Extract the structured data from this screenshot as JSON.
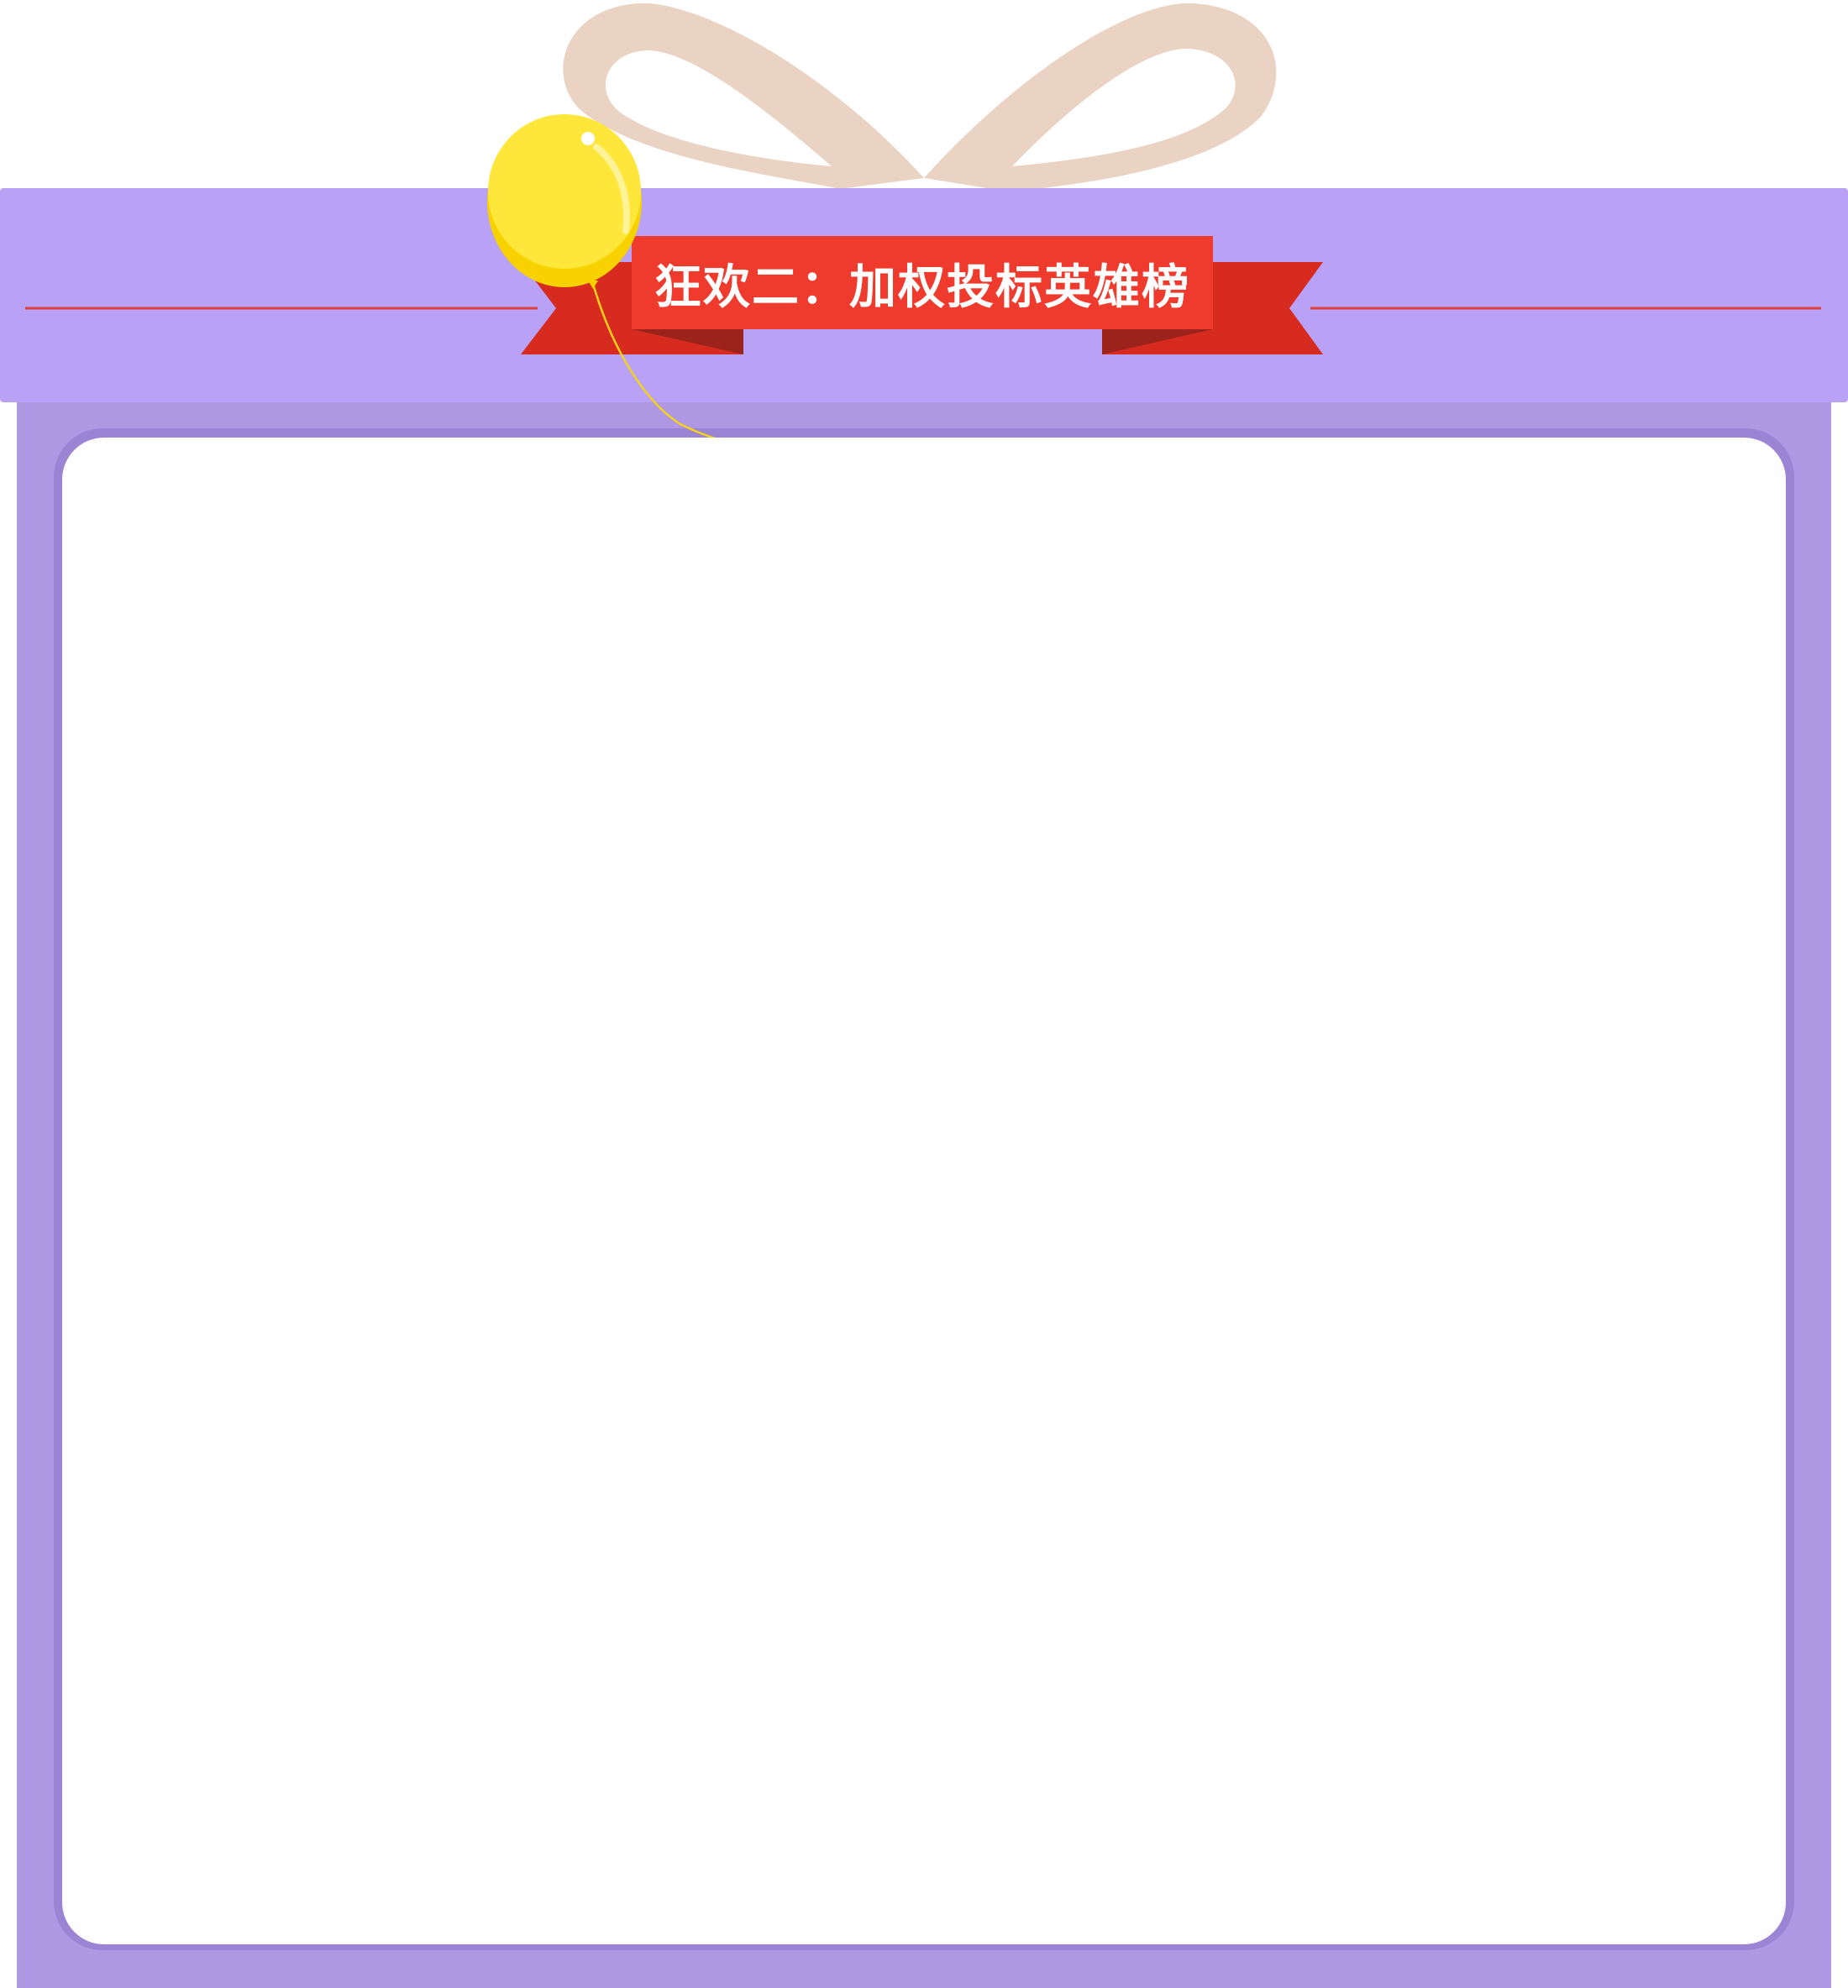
{
  "banner": {
    "title": "狂欢二：加权投标英雄榜"
  },
  "colors": {
    "lid": "#b9a1f5",
    "box_body": "#ae98e4",
    "box_inner_shadow": "#9b84d3",
    "panel": "#fefefe",
    "bow": "#ebd3c4",
    "ribbon_front": "#ef3b2d",
    "ribbon_back": "#d82b1f",
    "ribbon_fold": "#9c231b",
    "divider_line": "#e0413a",
    "balloon": "#ffe63a",
    "balloon_shade": "#f7d200",
    "balloon_string": "#f2d21a"
  },
  "icons": {
    "bow": "gift-bow-icon",
    "balloon": "balloon-icon",
    "ribbon": "ribbon-banner-icon"
  }
}
